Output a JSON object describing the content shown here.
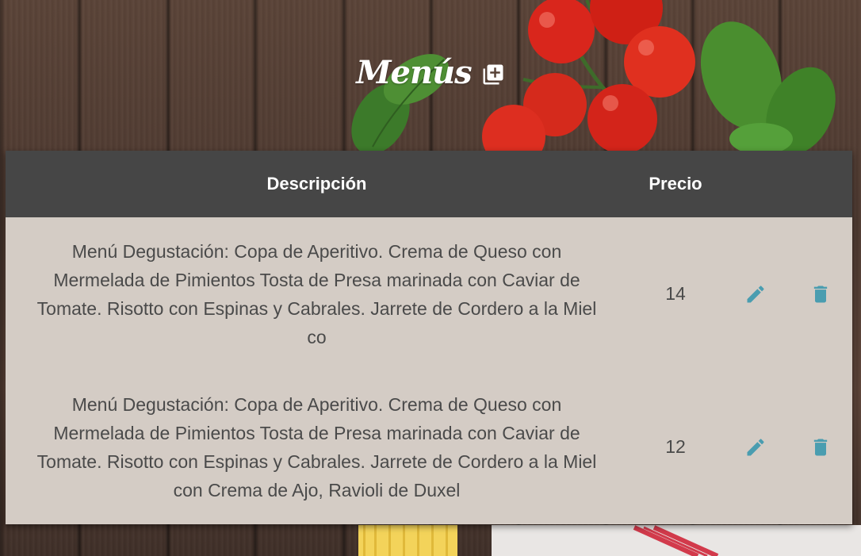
{
  "header": {
    "title": "Menús",
    "add_icon": "add-box-icon"
  },
  "table": {
    "columns": {
      "description": "Descripción",
      "price": "Precio"
    },
    "rows": [
      {
        "description": "Menú Degustación: Copa de Aperitivo. Crema de Queso con Mermelada de Pimientos Tosta de Presa marinada con Caviar de Tomate. Risotto con Espinas y Cabrales. Jarrete de Cordero a la Miel co",
        "price": "14",
        "edit_icon": "pencil-icon",
        "delete_icon": "trash-icon"
      },
      {
        "description": "Menú Degustación: Copa de Aperitivo. Crema de Queso con Mermelada de Pimientos Tosta de Presa marinada con Caviar de Tomate. Risotto con Espinas y Cabrales. Jarrete de Cordero a la Miel con Crema de Ajo, Ravioli de Duxel",
        "price": "12",
        "edit_icon": "pencil-icon",
        "delete_icon": "trash-icon"
      }
    ]
  },
  "colors": {
    "header_bg": "#464646",
    "table_bg": "#d4ccc5",
    "action_icon": "#4a9db0",
    "text": "#4a4a4a"
  }
}
